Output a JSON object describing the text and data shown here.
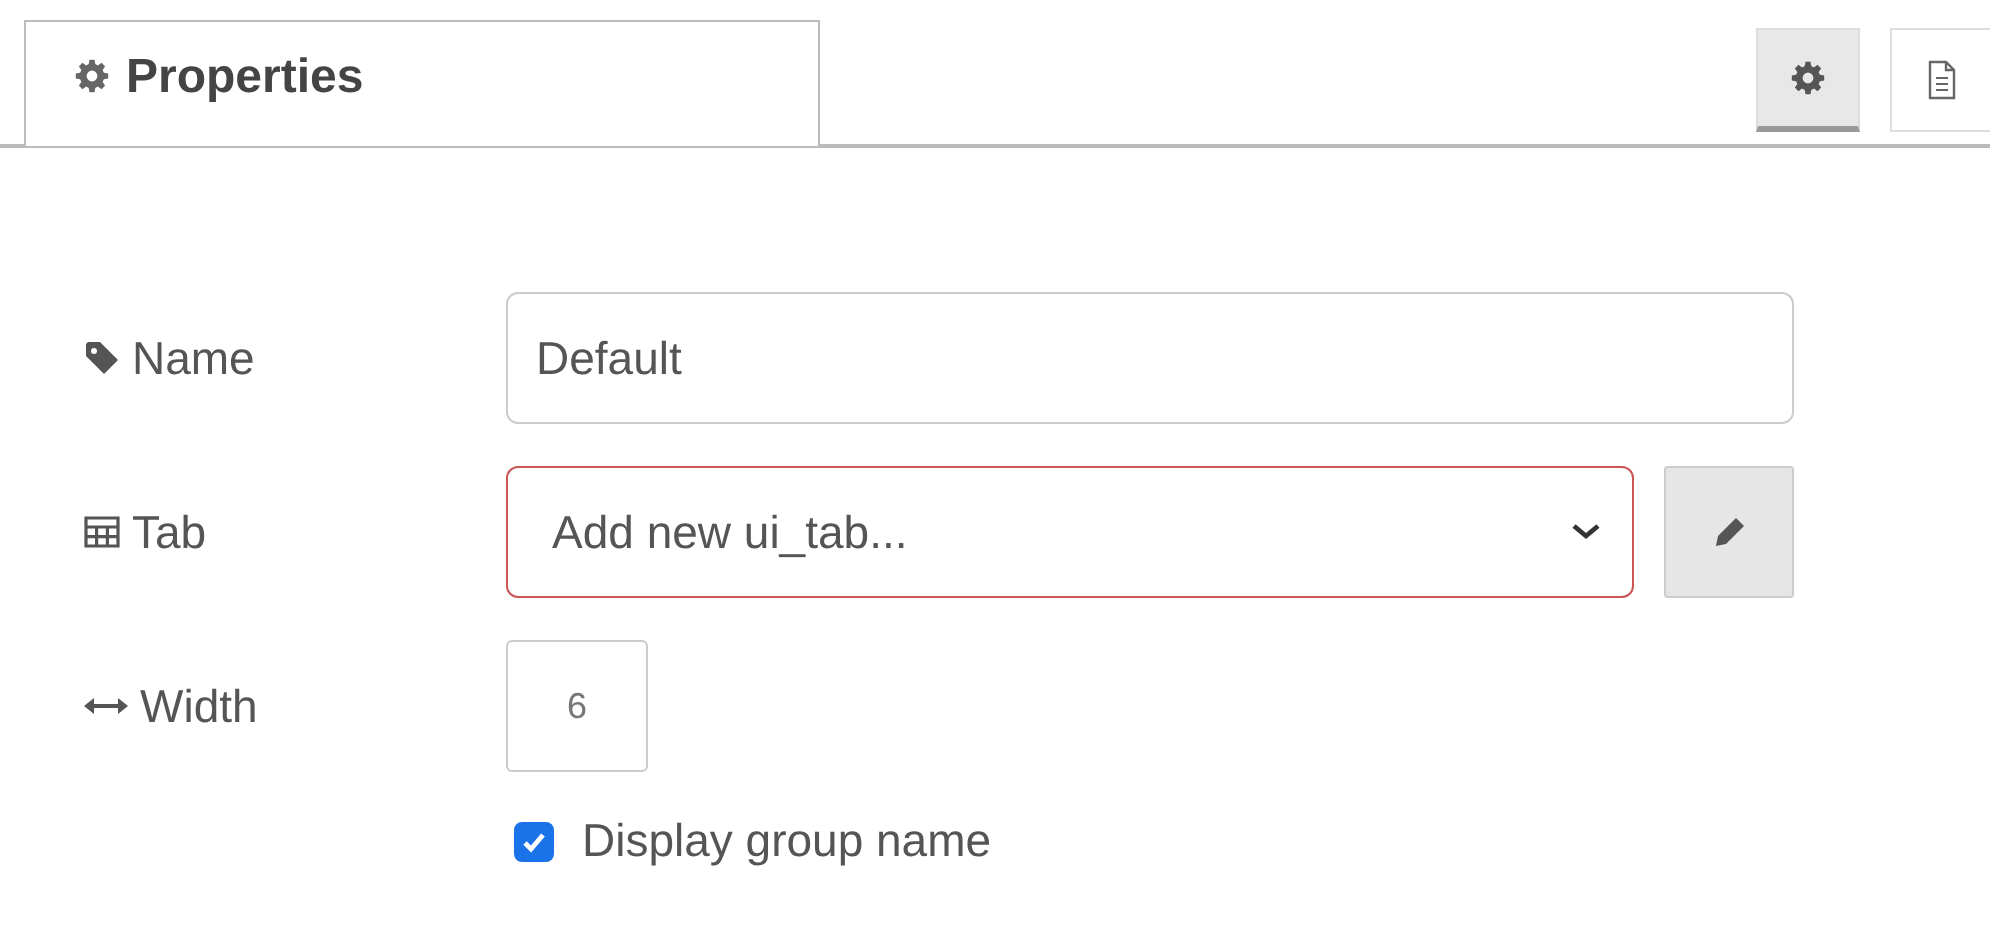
{
  "tabs": [
    {
      "label": "Properties",
      "selected": true
    }
  ],
  "side_buttons": [
    {
      "kind": "settings",
      "selected": true
    },
    {
      "kind": "document",
      "selected": false
    }
  ],
  "fields": [
    {
      "kind": "text",
      "label": "Name",
      "value": "Default"
    },
    {
      "kind": "select",
      "label": "Tab",
      "value": "Add new ui_tab...",
      "invalid": true
    },
    {
      "kind": "size",
      "label": "Width",
      "value": "6"
    }
  ],
  "checkbox": {
    "label": "Display group name",
    "checked": true
  }
}
